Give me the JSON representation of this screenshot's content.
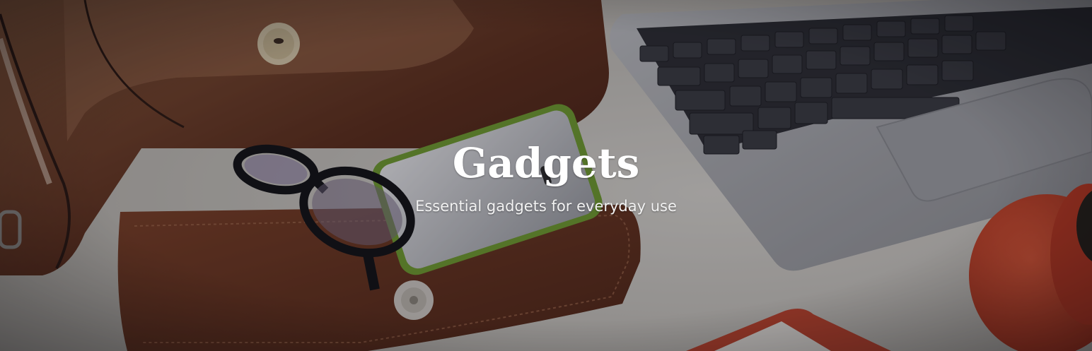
{
  "hero": {
    "title": "Gadgets",
    "subtitle": "Essential gadgets for everyday use"
  },
  "colors": {
    "desk": "#cfccc5",
    "leather": "#6a3420",
    "laptop": "#a7a8ab",
    "keys": "#2b2c31",
    "cup": "#d9482b",
    "text": "#ffffff"
  }
}
